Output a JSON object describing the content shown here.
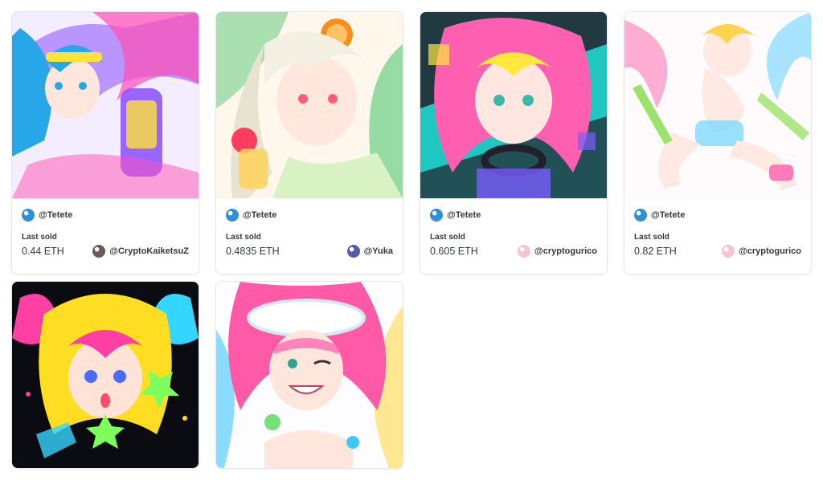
{
  "cards": [
    {
      "creator": "@Tetete",
      "sold_label": "Last sold",
      "price": "0.44 ETH",
      "owner": "@CryptoKaiketsuZ",
      "colors": {
        "bg": "#f4ecff",
        "a": "#27a7e8",
        "b": "#ff4fb5",
        "c": "#ffe23a",
        "d": "#8a4dff"
      }
    },
    {
      "creator": "@Tetete",
      "sold_label": "Last sold",
      "price": "0.4835 ETH",
      "owner": "@Yuka",
      "colors": {
        "bg": "#fff7ec",
        "a": "#ff8c1a",
        "b": "#42c46a",
        "c": "#ff3d5e",
        "d": "#ffd25a"
      }
    },
    {
      "creator": "@Tetete",
      "sold_label": "Last sold",
      "price": "0.605 ETH",
      "owner": "@cryptogurico",
      "colors": {
        "bg": "#1fc7c0",
        "a": "#ff5fb0",
        "b": "#ffe83d",
        "c": "#7b5cff",
        "d": "#22202a"
      }
    },
    {
      "creator": "@Tetete",
      "sold_label": "Last sold",
      "price": "0.82 ETH",
      "owner": "@cryptogurico",
      "colors": {
        "bg": "#fffafc",
        "a": "#ff7ab8",
        "b": "#9be36a",
        "c": "#ffd34d",
        "d": "#6ed6ff"
      }
    },
    {
      "creator": "",
      "sold_label": "",
      "price": "",
      "owner": "",
      "colors": {
        "bg": "#0b0b12",
        "a": "#ffdd22",
        "b": "#ff3fa4",
        "c": "#34d6ff",
        "d": "#7dff5c"
      }
    },
    {
      "creator": "",
      "sold_label": "",
      "price": "",
      "owner": "",
      "colors": {
        "bg": "#fdfdff",
        "a": "#ff5aa8",
        "b": "#3ec7ff",
        "c": "#ffd84a",
        "d": "#74e07a"
      }
    }
  ],
  "avatar_colors": {
    "creator": "#2f8fd8",
    "owner_0": "#6b5a55",
    "owner_1": "#5a5aa8",
    "owner_2": "#f2c4d6",
    "owner_3": "#f2c4d6"
  }
}
